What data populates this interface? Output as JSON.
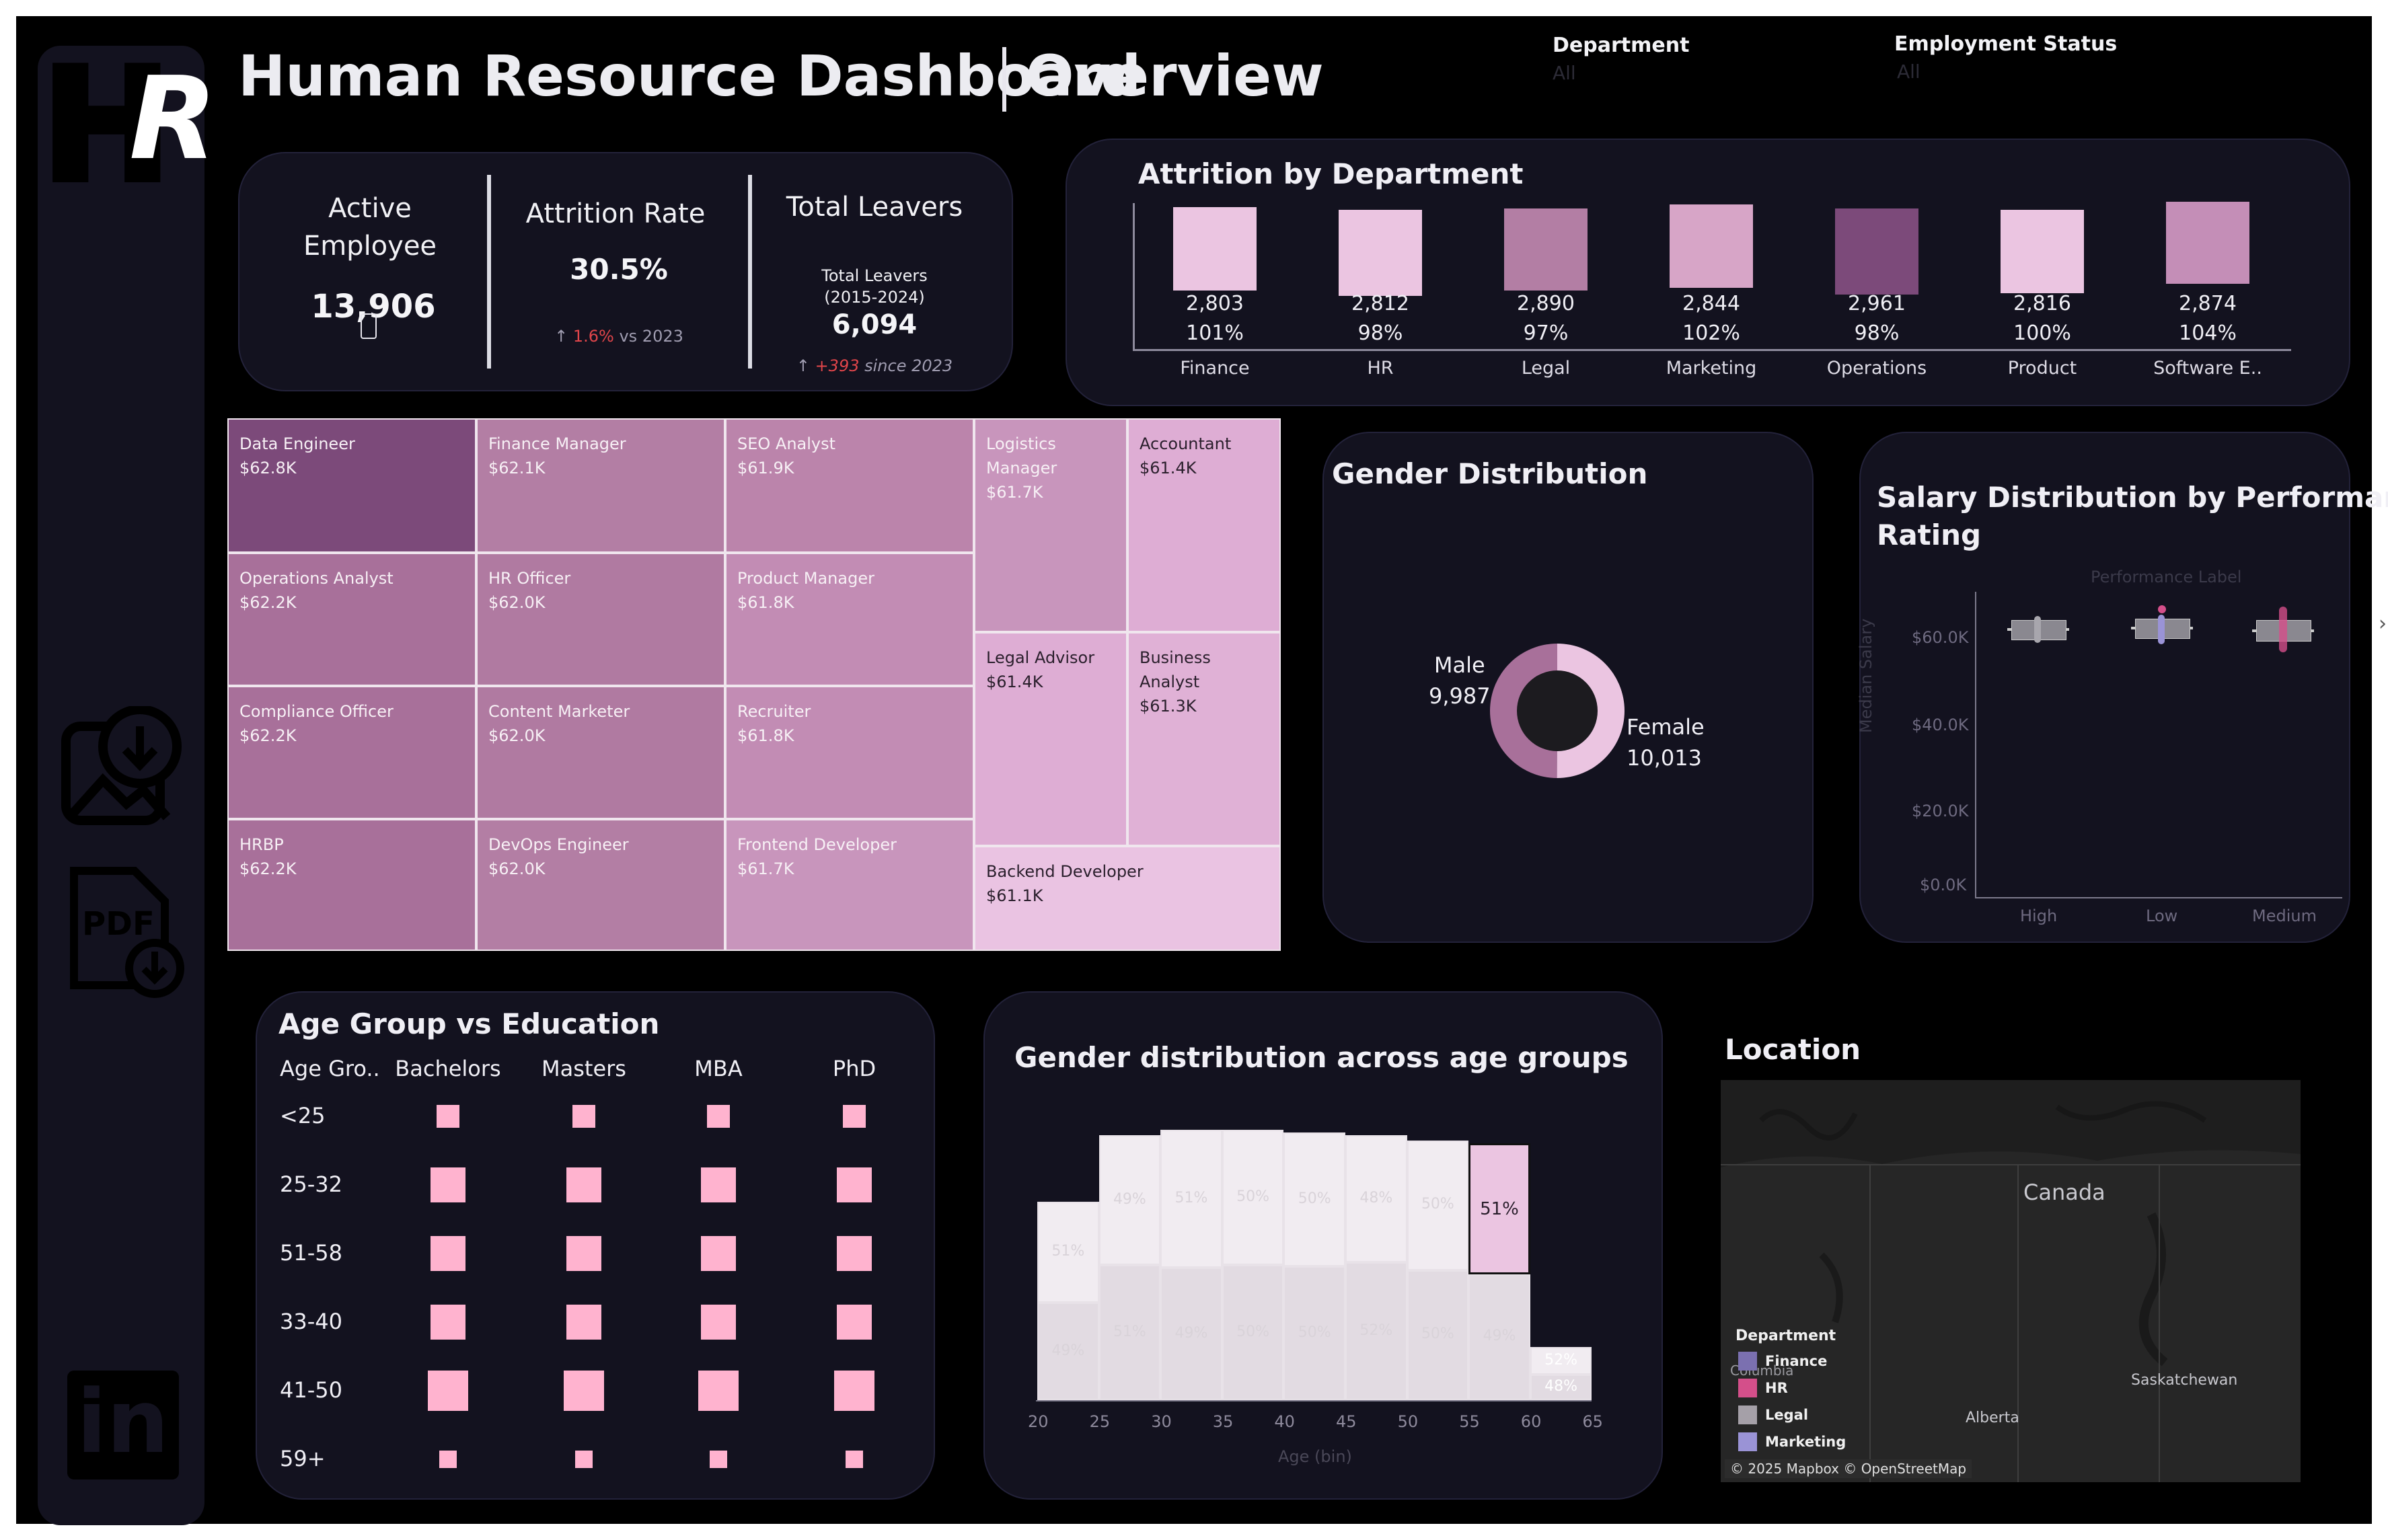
{
  "header": {
    "title": "Human Resource Dashboard",
    "subtitle": "Overview"
  },
  "logo": {
    "text_h": "H",
    "text_r": "R"
  },
  "filters": [
    {
      "label": "Department",
      "value": "All"
    },
    {
      "label": "Employment Status",
      "value": "All"
    }
  ],
  "kpis": {
    "active": {
      "label_line1": "Active",
      "label_line2": "Employee",
      "value": "13,906"
    },
    "attrition": {
      "label": "Attrition Rate",
      "value": "30.5%",
      "delta": "1.6%",
      "delta_suffix": " vs 2023"
    },
    "leavers": {
      "label": "Total Leavers",
      "sub_line1": "Total Leavers",
      "sub_line2": "(2015-2024)",
      "value": "6,094",
      "delta": "+393",
      "delta_suffix": " since 2023"
    }
  },
  "attrition_by_department": {
    "title": "Attrition by Department",
    "items": [
      {
        "name": "Finance",
        "count": "2,803",
        "pct": "101%",
        "color": "#ebc5e1"
      },
      {
        "name": "HR",
        "count": "2,812",
        "pct": "98%",
        "color": "#ebc5e1"
      },
      {
        "name": "Legal",
        "count": "2,890",
        "pct": "97%",
        "color": "#b37ea4"
      },
      {
        "name": "Marketing",
        "count": "2,844",
        "pct": "102%",
        "color": "#d7a5c7"
      },
      {
        "name": "Operations",
        "count": "2,961",
        "pct": "98%",
        "color": "#7c4a7a"
      },
      {
        "name": "Product",
        "count": "2,816",
        "pct": "100%",
        "color": "#ebc5e1"
      },
      {
        "name": "Software E..",
        "count": "2,874",
        "pct": "104%",
        "color": "#c48eb7"
      }
    ]
  },
  "treemap": [
    {
      "role": "Data Engineer",
      "salary": "$62.8K",
      "color": "#7c4a7a"
    },
    {
      "role": "Finance Manager",
      "salary": "$62.1K",
      "color": "#b37ea4"
    },
    {
      "role": "SEO Analyst",
      "salary": "$61.9K",
      "color": "#bb84ab"
    },
    {
      "role": "Logistics Manager",
      "salary": "$61.7K",
      "color": "#c895bc"
    },
    {
      "role": "Accountant",
      "salary": "$61.4K",
      "color": "#deadd4"
    },
    {
      "role": "Operations Analyst",
      "salary": "$62.2K",
      "color": "#a8709a"
    },
    {
      "role": "HR Officer",
      "salary": "$62.0K",
      "color": "#b07aa1"
    },
    {
      "role": "Product Manager",
      "salary": "$61.8K",
      "color": "#c28cb4"
    },
    {
      "role": "Legal Advisor",
      "salary": "$61.4K",
      "color": "#deadd4"
    },
    {
      "role": "Business Analyst",
      "salary": "$61.3K",
      "color": "#e0b1d6"
    },
    {
      "role": "Compliance Officer",
      "salary": "$62.2K",
      "color": "#a8709a"
    },
    {
      "role": "Content Marketer",
      "salary": "$62.0K",
      "color": "#b07aa1"
    },
    {
      "role": "Recruiter",
      "salary": "$61.8K",
      "color": "#c28cb4"
    },
    {
      "role": "HRBP",
      "salary": "$62.2K",
      "color": "#a8709a"
    },
    {
      "role": "DevOps Engineer",
      "salary": "$62.0K",
      "color": "#b37ea4"
    },
    {
      "role": "Frontend Developer",
      "salary": "$61.7K",
      "color": "#c895bc"
    },
    {
      "role": "Backend Developer",
      "salary": "$61.1K",
      "color": "#eac3e2"
    }
  ],
  "gender": {
    "title": "Gender Distribution",
    "male_label": "Male",
    "male_value": "9,987",
    "male_count": 9987,
    "male_color": "#a8709a",
    "female_label": "Female",
    "female_value": "10,013",
    "female_count": 10013,
    "female_color": "#ebc5e1"
  },
  "salary_perf": {
    "title_line1": "Salary Distribution by Performance",
    "title_line2": "Rating",
    "top_label": "Performance Label",
    "y_label": "Median Salary",
    "y_ticks": [
      "$60.0K",
      "$40.0K",
      "$20.0K",
      "$0.0K"
    ],
    "x_ticks": [
      "High",
      "Low",
      "Medium"
    ]
  },
  "age_education": {
    "title": "Age Group vs Education",
    "corner": "Age Gro..",
    "columns": [
      "Bachelors",
      "Masters",
      "MBA",
      "PhD"
    ],
    "rows": [
      {
        "label": "<25",
        "sizes": [
          0.57,
          0.57,
          0.57,
          0.57
        ]
      },
      {
        "label": "25-32",
        "sizes": [
          0.86,
          0.86,
          0.86,
          0.86
        ]
      },
      {
        "label": "51-58",
        "sizes": [
          0.86,
          0.86,
          0.86,
          0.86
        ]
      },
      {
        "label": "33-40",
        "sizes": [
          0.86,
          0.86,
          0.86,
          0.86
        ]
      },
      {
        "label": "41-50",
        "sizes": [
          1,
          1,
          1,
          1
        ]
      },
      {
        "label": "59+",
        "sizes": [
          0.43,
          0.43,
          0.43,
          0.43
        ]
      }
    ]
  },
  "chart_data": {
    "type": "bar",
    "title": "Gender distribution across age groups",
    "xlabel": "Age (bin)",
    "x_ticks": [
      "20",
      "25",
      "30",
      "35",
      "40",
      "45",
      "50",
      "55",
      "60",
      "65"
    ],
    "categories": [
      "20",
      "25",
      "30",
      "35",
      "40",
      "45",
      "50",
      "55",
      "60"
    ],
    "series": [
      {
        "values": [
          49,
          51,
          49,
          50,
          50,
          52,
          50,
          49,
          48
        ]
      },
      {
        "values": [
          51,
          49,
          51,
          50,
          50,
          48,
          50,
          51,
          52
        ]
      }
    ],
    "bottom_labels": [
      "49%",
      "51%",
      "49%",
      "50%",
      "50%",
      "52%",
      "50%",
      "49%",
      "48%"
    ],
    "top_labels": [
      "51%",
      "49%",
      "51%",
      "50%",
      "50%",
      "48%",
      "50%",
      "51%",
      "52%"
    ],
    "relative_totals": [
      0.75,
      1.0,
      1.02,
      1.02,
      1.01,
      1.0,
      0.98,
      0.97,
      0.2
    ]
  },
  "location": {
    "title": "Location",
    "country": "Canada",
    "places": [
      "Columbia",
      "Alberta",
      "Saskatchewan"
    ],
    "legend_title": "Department",
    "legend": [
      {
        "name": "Finance",
        "color": "#7b70b0"
      },
      {
        "name": "HR",
        "color": "#d44f8a"
      },
      {
        "name": "Legal",
        "color": "#a5a0a8"
      },
      {
        "name": "Marketing",
        "color": "#9a93d6"
      }
    ],
    "attribution": "© 2025 Mapbox © OpenStreetMap"
  }
}
